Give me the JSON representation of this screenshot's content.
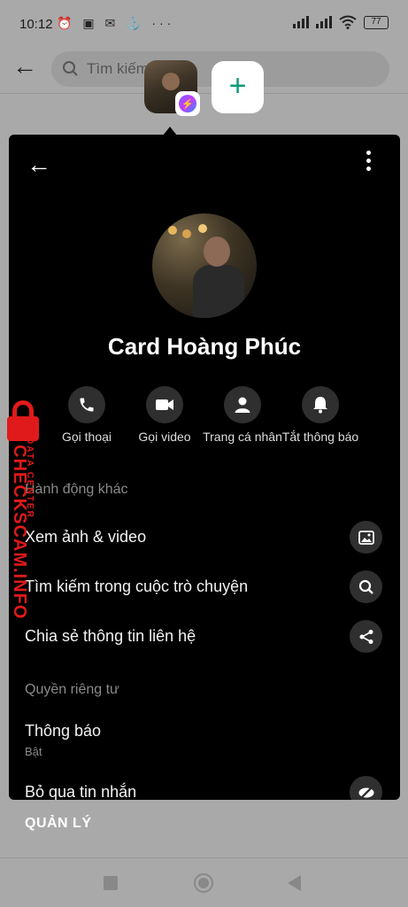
{
  "status_bar": {
    "time": "10:12",
    "notif_icons": "⏰ ▣ ✉ ⚓ ···",
    "battery": "77"
  },
  "background": {
    "search_placeholder": "Tìm kiếm"
  },
  "sheet": {
    "contact_name": "Card Hoàng Phúc",
    "actions": [
      {
        "label": "Gọi thoại",
        "icon": "phone-icon"
      },
      {
        "label": "Gọi video",
        "icon": "video-camera-icon"
      },
      {
        "label": "Trang cá nhân",
        "icon": "person-icon"
      },
      {
        "label": "Tắt thông báo",
        "icon": "bell-icon"
      }
    ],
    "section_other": "Hành động khác",
    "rows_other": [
      {
        "label": "Xem ảnh & video",
        "icon": "image-icon"
      },
      {
        "label": "Tìm kiếm trong cuộc trò chuyện",
        "icon": "search-icon"
      },
      {
        "label": "Chia sẻ thông tin liên hệ",
        "icon": "share-icon"
      }
    ],
    "section_privacy": "Quyền riêng tư",
    "notifications": {
      "label": "Thông báo",
      "sub": "Bật"
    },
    "ignore_messages": {
      "label": "Bỏ qua tin nhắn",
      "icon": "eye-slash-icon"
    }
  },
  "manage_label": "QUẢN LÝ",
  "watermark": {
    "main": "CHECKSCAM.INFO",
    "sub": "DATA CENTER"
  },
  "colors": {
    "sheet_bg": "#000000",
    "icon_circle": "#2f2f2f",
    "accent_add": "#0a9a7a",
    "watermark": "#e01a1a"
  }
}
